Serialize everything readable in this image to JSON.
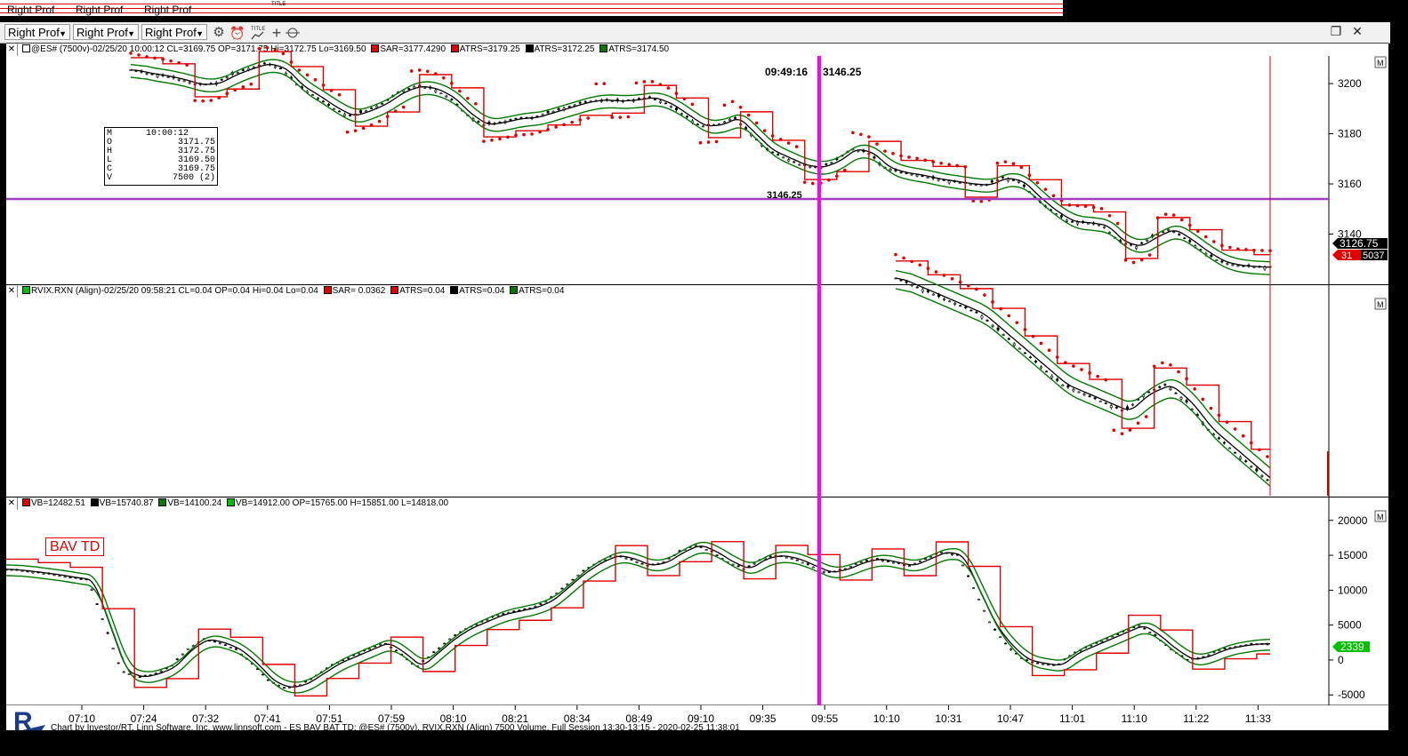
{
  "ghost_toolbar": {
    "items": [
      "Right Prof",
      "Right Prof",
      "Right Prof"
    ],
    "title_icon": "TITLE"
  },
  "toolbar": {
    "dropdowns": [
      "Right Prof",
      "Right Prof",
      "Right Prof"
    ],
    "icons": [
      "gear-icon",
      "alarm-clock-icon",
      "title-chart-icon",
      "crosshair-icon",
      "scale-icon"
    ],
    "title_icon_label": "TITLE"
  },
  "pane1": {
    "header": {
      "main": "@ES# (7500v)-02/25/20 10:00:12 CL=3169.75 OP=3171.75 Hi=3172.75 Lo=3169.50",
      "studies": [
        {
          "color": "#e00000",
          "text": "SAR=3177.4290"
        },
        {
          "color": "#e00000",
          "text": "ATRS=3179.25"
        },
        {
          "color": "#000000",
          "text": "ATRS=3172.25"
        },
        {
          "color": "#007a00",
          "text": "ATRS=3174.50"
        }
      ]
    },
    "y_ticks": [
      "3200",
      "3180",
      "3160",
      "3140"
    ],
    "time_label": "09:49:16",
    "time_price": "3146.25",
    "hline_price": "3146.25",
    "last_price": "3126.75",
    "vol_a": "31",
    "vol_b": "5037",
    "m_button": "M",
    "ohlc": {
      "M": "10:00:12",
      "O": "3171.75",
      "H": "3172.75",
      "L": "3169.50",
      "C": "3169.75",
      "V": "7500  (2)"
    }
  },
  "pane2": {
    "header": {
      "main": "RVIX.RXN (Align)-02/25/20 09:58:21 CL=0.04 OP=0.04 Hi=0.04 Lo=0.04",
      "studies": [
        {
          "color": "#e00000",
          "text": "SAR=  0.0362"
        },
        {
          "color": "#e00000",
          "text": "ATRS=0.04"
        },
        {
          "color": "#000000",
          "text": "ATRS=0.04"
        },
        {
          "color": "#007a00",
          "text": "ATRS=0.04"
        }
      ]
    },
    "m_button": "M"
  },
  "pane3": {
    "header": {
      "studies": [
        {
          "color": "#e00000",
          "text": "VB=12482.51"
        },
        {
          "color": "#000000",
          "text": "VB=15740.87"
        },
        {
          "color": "#007a00",
          "text": "VB=14100.24"
        },
        {
          "color": "#00c000",
          "text": "VB=14912.00 OP=15765.00 H=15851.00 L=14818.00"
        }
      ]
    },
    "label": "BAV TD",
    "y_ticks": [
      "20000",
      "15000",
      "10000",
      "5000",
      "0",
      "-5000"
    ],
    "last_value": "2339",
    "m_button": "M"
  },
  "time_axis": [
    "07:10",
    "07:24",
    "07:32",
    "07:41",
    "07:51",
    "07:59",
    "08:10",
    "08:21",
    "08:34",
    "08:49",
    "09:10",
    "09:35",
    "09:55",
    "10:10",
    "10:31",
    "10:47",
    "11:01",
    "11:10",
    "11:22",
    "11:33"
  ],
  "footer": {
    "credit": "Chart by Investor/RT, Linn Software, Inc. www.linnsoft.com - ES BAV BAT TD: @ES# (7500v), RVIX.RXN (Align) 7500 Volume, Full Session 13:30-13:15 - 2020-02-25 11:38:01",
    "logo_letter": "R"
  },
  "colors": {
    "red": "#e00000",
    "green": "#007a00",
    "black": "#000000",
    "magenta": "#ff00ff",
    "purple_line": "#a040c0"
  },
  "series": {
    "price_close": [
      3205.5,
      3204,
      3203,
      3201.5,
      3199.5,
      3200,
      3203.5,
      3206,
      3208,
      3206,
      3199,
      3195,
      3190.5,
      3187,
      3189,
      3192,
      3196.5,
      3199,
      3198,
      3194.5,
      3188,
      3183.5,
      3184.5,
      3186,
      3186.5,
      3188.5,
      3190.5,
      3192.5,
      3193.5,
      3193,
      3193.5,
      3194.5,
      3192,
      3187.5,
      3183,
      3183.5,
      3186.5,
      3180,
      3173.5,
      3170.5,
      3167.5,
      3166.5,
      3169,
      3174,
      3172.5,
      3166.5,
      3164.5,
      3163.5,
      3162,
      3161,
      3160,
      3159.5,
      3162.5,
      3161,
      3154.5,
      3149,
      3145,
      3144.5,
      3143.5,
      3137,
      3135,
      3139,
      3142,
      3138,
      3133,
      3129,
      3127.5,
      3127,
      3126.75
    ],
    "vix_close": [
      0.048,
      0.047,
      0.046,
      0.045,
      0.044,
      0.042,
      0.04,
      0.038,
      0.036,
      0.035,
      0.034,
      0.033,
      0.035,
      0.036,
      0.034,
      0.031,
      0.029,
      0.027,
      0.025
    ],
    "bav_close": [
      13000,
      12800,
      12500,
      12200,
      11800,
      11500,
      5000,
      -1500,
      -2500,
      -2000,
      -1000,
      1500,
      3000,
      2500,
      1500,
      -500,
      -3000,
      -4000,
      -3500,
      -2000,
      -500,
      500,
      1500,
      2500,
      1000,
      -1000,
      1000,
      3000,
      4500,
      5500,
      6500,
      7000,
      7500,
      8500,
      10500,
      12500,
      14000,
      15000,
      14500,
      13500,
      14000,
      15500,
      16500,
      15500,
      14000,
      13000,
      14500,
      15000,
      14500,
      13500,
      12500,
      13000,
      14000,
      14500,
      14000,
      13500,
      14500,
      15500,
      15000,
      10000,
      5000,
      2000,
      0,
      -500,
      -800,
      1000,
      2000,
      3000,
      4000,
      5000,
      3500,
      1500,
      0,
      500,
      1500,
      2000,
      2300,
      2339
    ]
  }
}
